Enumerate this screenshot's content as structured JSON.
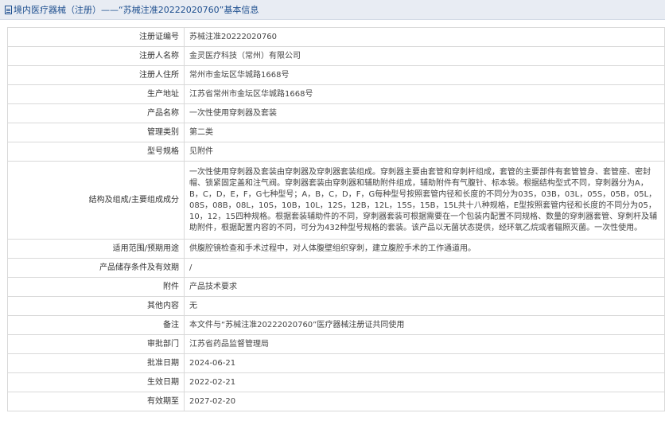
{
  "header": {
    "icon": "document-icon",
    "title": "境内医疗器械（注册）——“苏械注准20222020760”基本信息"
  },
  "rows": [
    {
      "label": "注册证编号",
      "value": "苏械注准20222020760"
    },
    {
      "label": "注册人名称",
      "value": "金灵医疗科技（常州）有限公司"
    },
    {
      "label": "注册人住所",
      "value": "常州市金坛区华城路1668号"
    },
    {
      "label": "生产地址",
      "value": "江苏省常州市金坛区华城路1668号"
    },
    {
      "label": "产品名称",
      "value": "一次性使用穿刺器及套装"
    },
    {
      "label": "管理类别",
      "value": "第二类"
    },
    {
      "label": "型号规格",
      "value": "见附件"
    },
    {
      "label": "结构及组成/主要组成成分",
      "value": "一次性使用穿刺器及套装由穿刺器及穿刺器套装组成。穿刺器主要由套管和穿刺杆组成，套管的主要部件有套管管身、套管座、密封帽、锁紧固定盖和注气阀。穿刺器套装由穿刺器和辅助附件组成，辅助附件有气腹针、标本袋。根据结构型式不同，穿刺器分为A，B，C，D，E，F，G七种型号；A，B，C，D，F，G每种型号按照套管内径和长度的不同分为03S，03B，03L，05S，05B，05L，08S，08B，08L，10S，10B，10L，12S，12B，12L，15S，15B，15L共十八种规格，E型按照套管内径和长度的不同分为05，10，12，15四种规格。根据套装辅助件的不同，穿刺器套装可根据需要在一个包装内配置不同规格、数量的穿刺器套管、穿刺杆及辅助附件，根据配置内容的不同，可分为432种型号规格的套装。该产品以无菌状态提供，经环氧乙烷或者辐照灭菌。一次性使用。"
    },
    {
      "label": "适用范围/预期用途",
      "value": "供腹腔镜检查和手术过程中，对人体腹壁组织穿刺，建立腹腔手术的工作通道用。"
    },
    {
      "label": "产品储存条件及有效期",
      "value": "/"
    },
    {
      "label": "附件",
      "value": "产品技术要求"
    },
    {
      "label": "其他内容",
      "value": "无"
    },
    {
      "label": "备注",
      "value": "本文件与“苏械注准20222020760”医疗器械注册证共同使用"
    },
    {
      "label": "审批部门",
      "value": "江苏省药品监督管理局"
    },
    {
      "label": "批准日期",
      "value": "2024-06-21"
    },
    {
      "label": "生效日期",
      "value": "2022-02-21"
    },
    {
      "label": "有效期至",
      "value": "2027-02-20"
    }
  ]
}
